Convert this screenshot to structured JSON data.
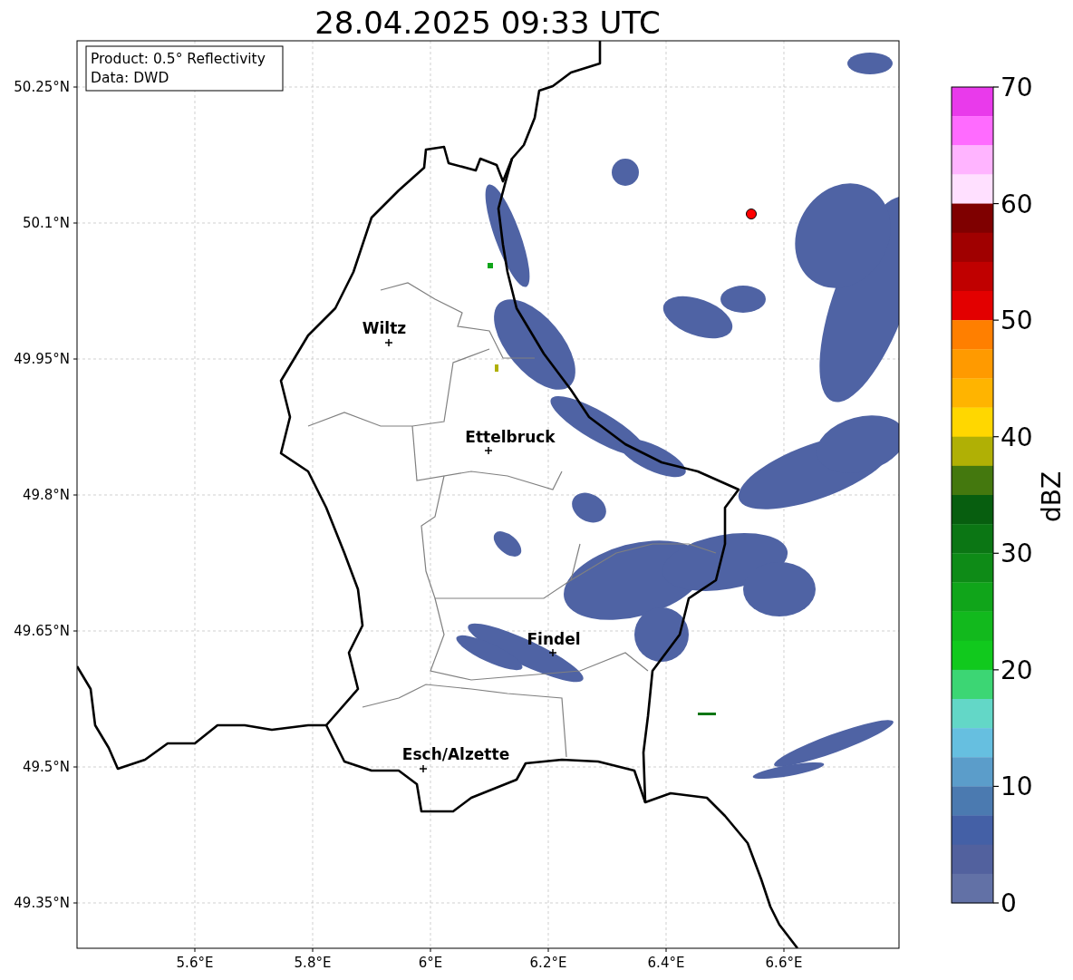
{
  "title": "28.04.2025 09:33 UTC",
  "info_box": [
    "Product: 0.5° Reflectivity",
    "Data: DWD"
  ],
  "y_ticks": [
    "50.25°N",
    "50.1°N",
    "49.95°N",
    "49.8°N",
    "49.65°N",
    "49.5°N",
    "49.35°N"
  ],
  "x_ticks": [
    "5.6°E",
    "5.8°E",
    "6°E",
    "6.2°E",
    "6.4°E",
    "6.6°E"
  ],
  "cities": [
    {
      "name": "Wiltz"
    },
    {
      "name": "Ettelbruck"
    },
    {
      "name": "Findel"
    },
    {
      "name": "Esch/Alzette"
    }
  ],
  "colorbar": {
    "label": "dBZ",
    "ticks": [
      "70",
      "60",
      "50",
      "40",
      "30",
      "20",
      "10",
      "0"
    ],
    "segments": [
      {
        "color": "#e93aeb"
      },
      {
        "color": "#ff6bff"
      },
      {
        "color": "#ffb4ff"
      },
      {
        "color": "#ffe0ff"
      },
      {
        "color": "#7f0000"
      },
      {
        "color": "#a00000"
      },
      {
        "color": "#c00000"
      },
      {
        "color": "#e30000"
      },
      {
        "color": "#ff7f00"
      },
      {
        "color": "#ff9a00"
      },
      {
        "color": "#ffb400"
      },
      {
        "color": "#ffd700"
      },
      {
        "color": "#b0b005"
      },
      {
        "color": "#44780e"
      },
      {
        "color": "#075e0f"
      },
      {
        "color": "#0b7614"
      },
      {
        "color": "#0e8b17"
      },
      {
        "color": "#10a51a"
      },
      {
        "color": "#12b91d"
      },
      {
        "color": "#11c91d"
      },
      {
        "color": "#3cd674"
      },
      {
        "color": "#63d7c7"
      },
      {
        "color": "#66bfe0"
      },
      {
        "color": "#5b9dca"
      },
      {
        "color": "#4b7ab0"
      },
      {
        "color": "#4460a6"
      },
      {
        "color": "#52619e"
      },
      {
        "color": "#6271a6"
      }
    ]
  }
}
